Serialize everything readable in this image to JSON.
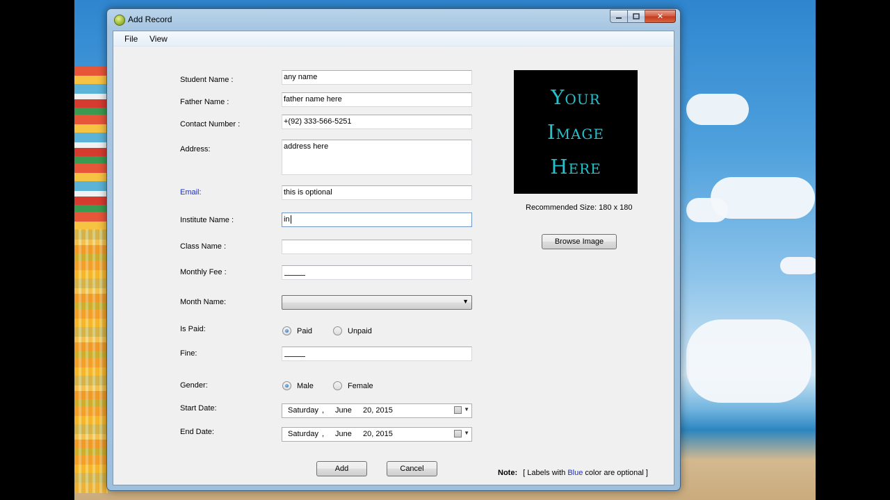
{
  "window": {
    "title": "Add Record"
  },
  "menu": {
    "file": "File",
    "view": "View"
  },
  "caption_buttons": {
    "close": "✕"
  },
  "form": {
    "student_name": {
      "label": "Student Name :",
      "value": "any name"
    },
    "father_name": {
      "label": "Father Name :",
      "value": "father name here"
    },
    "contact_number": {
      "label": "Contact Number :",
      "value": "+(92) 333-566-5251"
    },
    "address": {
      "label": "Address:",
      "value": "address here"
    },
    "email": {
      "label": "Email:",
      "value": "this is optional",
      "label_color": "#1f2fb0"
    },
    "institute_name": {
      "label": "Institute Name :",
      "value": "in"
    },
    "class_name": {
      "label": "Class Name :",
      "value": ""
    },
    "monthly_fee": {
      "label": "Monthly Fee :",
      "value": ""
    },
    "month_name": {
      "label": "Month Name:",
      "value": ""
    },
    "is_paid": {
      "label": "Is Paid:",
      "options": [
        "Paid",
        "Unpaid"
      ],
      "selected": "Paid"
    },
    "fine": {
      "label": "Fine:",
      "value": ""
    },
    "gender": {
      "label": "Gender:",
      "options": [
        "Male",
        "Female"
      ],
      "selected": "Male"
    },
    "start_date": {
      "label": "Start Date:",
      "weekday": "Saturday",
      "sep": ",",
      "month": "June",
      "day_year": "20, 2015"
    },
    "end_date": {
      "label": "End Date:",
      "weekday": "Saturday",
      "sep": ",",
      "month": "June",
      "day_year": "20, 2015"
    }
  },
  "image_panel": {
    "placeholder_lines": [
      "Your",
      "Image",
      "Here"
    ],
    "recommended": "Recommended Size: 180 x 180",
    "browse_button": "Browse Image"
  },
  "buttons": {
    "add": "Add",
    "cancel": "Cancel"
  },
  "note": {
    "prefix": "Note:",
    "text_before": "[ Labels with",
    "blue_word": "Blue",
    "text_after": "color are optional ]"
  },
  "colors": {
    "optional_label": "#1f2fb0",
    "image_text": "#22c2cf"
  }
}
